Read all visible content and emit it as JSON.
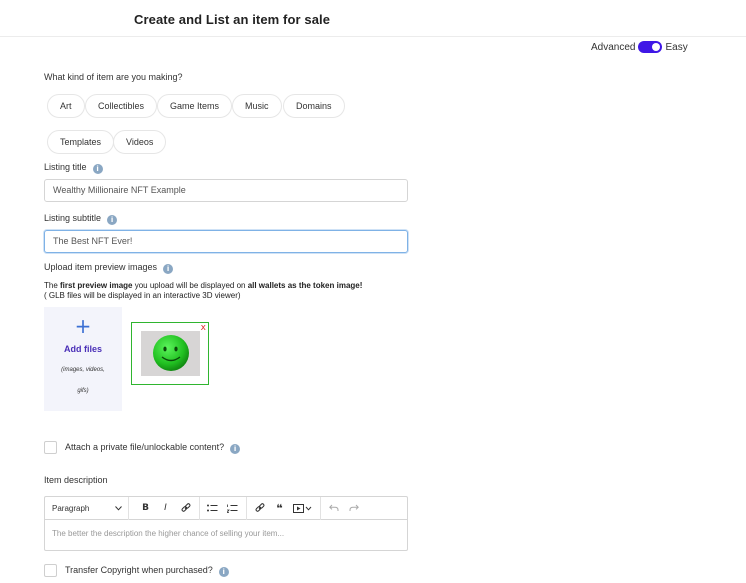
{
  "header": {
    "title": "Create and List an item for sale"
  },
  "mode": {
    "left": "Advanced",
    "right": "Easy",
    "accent": "#3f17e6"
  },
  "kind": {
    "question": "What kind of item are you making?",
    "options": [
      "Art",
      "Collectibles",
      "Game Items",
      "Music",
      "Domains",
      "Templates",
      "Videos"
    ]
  },
  "listing_title": {
    "label": "Listing title",
    "value": "Wealthy Millionaire NFT Example"
  },
  "listing_subtitle": {
    "label": "Listing subtitle",
    "value": "The Best NFT Ever!"
  },
  "upload": {
    "label": "Upload item preview images",
    "note_prefix": "The ",
    "note_bold1": "first preview image",
    "note_mid": " you upload will be displayed on ",
    "note_bold2": "all wallets as the token image!",
    "note_line2": "( GLB files will be displayed in an interactive 3D viewer)",
    "add_plus": "+",
    "add_label": "Add files",
    "hint_line1": "(images, videos,",
    "hint_line2": "gifs)",
    "remove_icon": "x"
  },
  "private_file": {
    "label": "Attach a private file/unlockable content?"
  },
  "description": {
    "label": "Item description",
    "format": "Paragraph",
    "placeholder": "The better the description the higher chance of selling your item..."
  },
  "toolbar": {
    "bold": "B",
    "italic": "I",
    "quote": "❝"
  },
  "copyright": {
    "label": "Transfer Copyright when purchased?"
  },
  "icons": {
    "info": "i"
  }
}
